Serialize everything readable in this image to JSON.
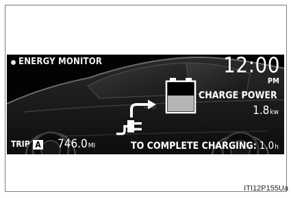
{
  "screen": {
    "title": "ENERGY MONITOR",
    "clock": {
      "time": "12:00",
      "period": "PM"
    },
    "charge_power": {
      "label": "CHARGE POWER",
      "value": "1.8",
      "unit": "kw"
    },
    "trip": {
      "label": "TRIP",
      "trip_id": "A",
      "value": "746.0",
      "unit": "MI"
    },
    "time_to_complete": {
      "label": "TO COMPLETE CHARGING:",
      "value": "1.0",
      "unit": "h"
    },
    "battery_level": 0.55,
    "icons": [
      "car-silhouette-icon",
      "battery-icon",
      "arrow-right-icon",
      "plug-icon"
    ]
  },
  "figure_ref": "ITI12P155Ua",
  "colors": {
    "screen_bg": "#030303",
    "text": "#ffffff",
    "car_outline": "#5a5a5a"
  }
}
